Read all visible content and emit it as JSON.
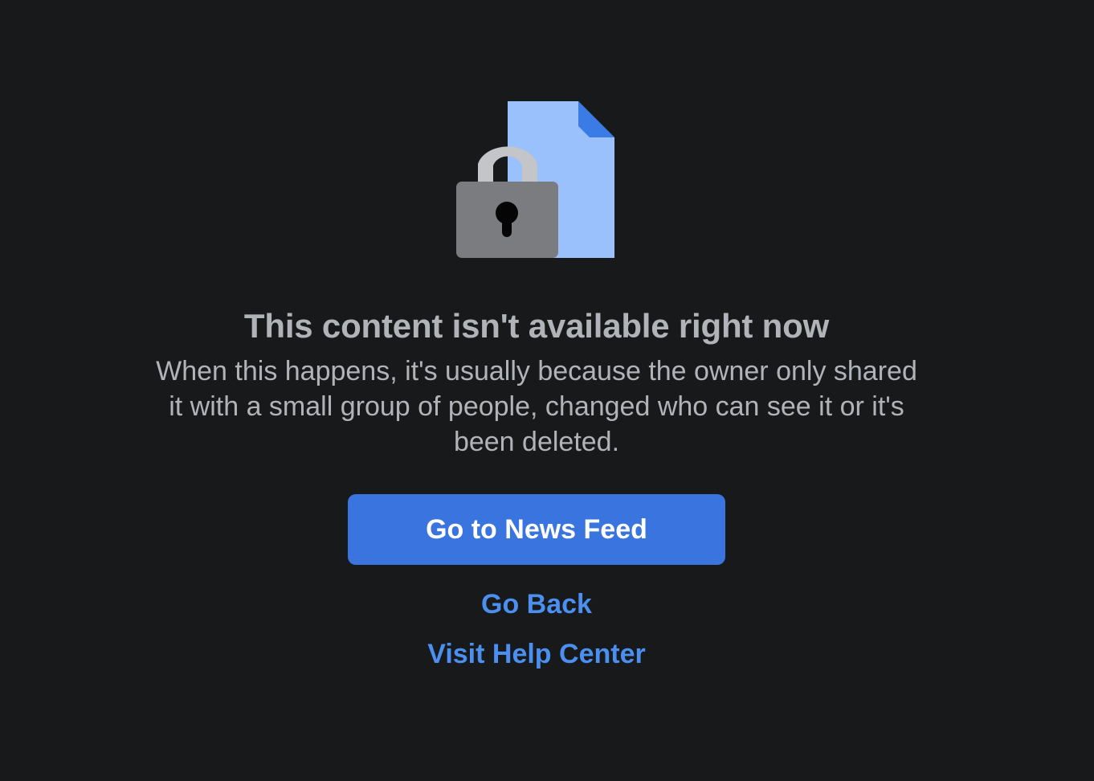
{
  "icons": {
    "illustration": "locked-document-icon"
  },
  "colors": {
    "background": "#18191a",
    "text_secondary": "#b0b3b8",
    "primary_button": "#3a74de",
    "link": "#4b8ff0",
    "document": "#9ac1fb",
    "document_fold": "#3b7be6",
    "lock_body": "#7b7c7f",
    "lock_shackle": "#c3c5c8"
  },
  "error": {
    "title": "This content isn't available right now",
    "message": "When this happens, it's usually because the owner only shared it with a small group of people, changed who can see it or it's been deleted."
  },
  "actions": {
    "primary_label": "Go to News Feed",
    "go_back_label": "Go Back",
    "help_center_label": "Visit Help Center"
  }
}
